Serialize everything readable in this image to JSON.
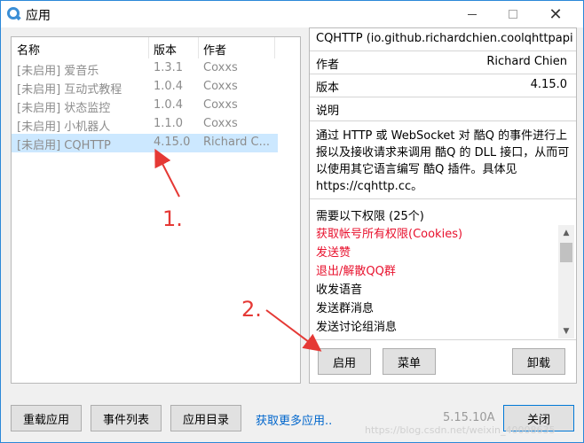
{
  "window": {
    "title": "应用",
    "icon": "app-logo-icon",
    "controls": {
      "minimize": "minimize-icon",
      "maximize": "maximize-icon",
      "close": "✕"
    }
  },
  "plugin_list": {
    "columns": [
      "名称",
      "版本",
      "作者"
    ],
    "rows": [
      {
        "name": "[未启用] 爱音乐",
        "version": "1.3.1",
        "author": "Coxxs"
      },
      {
        "name": "[未启用] 互动式教程",
        "version": "1.0.4",
        "author": "Coxxs"
      },
      {
        "name": "[未启用] 状态监控",
        "version": "1.0.4",
        "author": "Coxxs"
      },
      {
        "name": "[未启用] 小机器人",
        "version": "1.1.0",
        "author": "Coxxs"
      },
      {
        "name": "[未启用] CQHTTP",
        "version": "4.15.0",
        "author": "Richard C...",
        "selected": true
      }
    ]
  },
  "details": {
    "plugin_id": "CQHTTP (io.github.richardchien.coolqhttpapi)",
    "author_label": "作者",
    "author_value": "Richard Chien",
    "version_label": "版本",
    "version_value": "4.15.0",
    "description_label": "说明",
    "description": "通过 HTTP 或 WebSocket 对 酷Q 的事件进行上报以及接收请求来调用 酷Q 的 DLL 接口，从而可以使用其它语言编写 酷Q 插件。具体见 https://cqhttp.cc。",
    "permissions_title": "需要以下权限 (25个)",
    "permissions": [
      {
        "label": "获取帐号所有权限(Cookies)",
        "sensitive": true
      },
      {
        "label": "发送赞",
        "sensitive": true
      },
      {
        "label": "退出/解散QQ群",
        "sensitive": true
      },
      {
        "label": "收发语音",
        "sensitive": false
      },
      {
        "label": "发送群消息",
        "sensitive": false
      },
      {
        "label": "发送讨论组消息",
        "sensitive": false
      }
    ],
    "buttons": {
      "enable": "启用",
      "menu": "菜单",
      "uninstall": "卸载"
    }
  },
  "footer": {
    "reload": "重载应用",
    "events": "事件列表",
    "app_dir": "应用目录",
    "more_apps": "获取更多应用..",
    "version": "5.15.10A",
    "close": "关闭"
  },
  "annotations": {
    "step1": "1.",
    "step2": "2."
  },
  "watermark": "https://blog.csdn.net/weixin_40008635",
  "colors": {
    "accent": "#2b88d8",
    "selected_row": "#cce8ff",
    "sensitive": "#e8112d",
    "link": "#0066cc",
    "annotation": "#e53935"
  }
}
